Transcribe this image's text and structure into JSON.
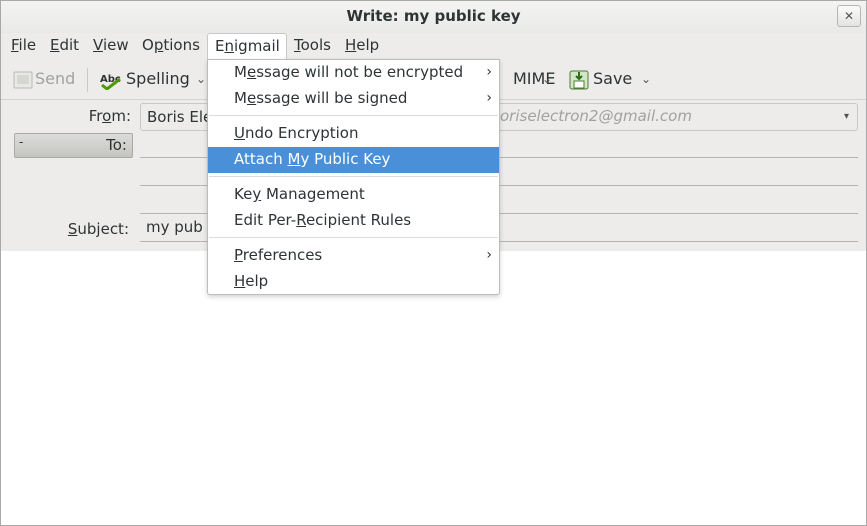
{
  "window": {
    "title": "Write: my public key",
    "close_glyph": "✕"
  },
  "menubar": [
    {
      "pre": "",
      "ul": "F",
      "post": "ile"
    },
    {
      "pre": "",
      "ul": "E",
      "post": "dit"
    },
    {
      "pre": "",
      "ul": "V",
      "post": "iew"
    },
    {
      "pre": "O",
      "ul": "p",
      "post": "tions"
    },
    {
      "pre": "E",
      "ul": "n",
      "post": "igmail"
    },
    {
      "pre": "",
      "ul": "T",
      "post": "ools"
    },
    {
      "pre": "",
      "ul": "H",
      "post": "elp"
    }
  ],
  "toolbar": {
    "send": "Send",
    "spelling": "Spelling",
    "smime": "MIME",
    "save": "Save",
    "chevron": "⌄"
  },
  "headers": {
    "from_label_pre": "Fr",
    "from_label_ul": "o",
    "from_label_post": "m:",
    "from_value": "Boris Ele",
    "from_email": "oriselectron2@gmail.com",
    "to_toggle": "-",
    "to_label": "To:",
    "subject_label_pre": "",
    "subject_label_ul": "S",
    "subject_label_post": "ubject:",
    "subject_value": "my pub",
    "combo_arrow": "▾"
  },
  "enigmail_menu": {
    "items": [
      {
        "pre": "M",
        "ul": "e",
        "post": "ssage will not be encrypted",
        "submenu": true
      },
      {
        "pre": "M",
        "ul": "e",
        "post": "ssage will be signed",
        "submenu": true
      },
      {
        "pre": "",
        "ul": "U",
        "post": "ndo Encryption",
        "submenu": false
      },
      {
        "pre": "Attach ",
        "ul": "M",
        "post": "y Public Key",
        "submenu": false,
        "highlighted": true
      },
      {
        "pre": "Ke",
        "ul": "y",
        "post": " Management",
        "submenu": false
      },
      {
        "pre": "Edit Per-",
        "ul": "R",
        "post": "ecipient Rules",
        "submenu": false
      },
      {
        "pre": "",
        "ul": "P",
        "post": "references",
        "submenu": true
      },
      {
        "pre": "",
        "ul": "H",
        "post": "elp",
        "submenu": false
      }
    ],
    "submenu_glyph": "›"
  },
  "colors": {
    "highlight": "#4a90d9",
    "chrome": "#edeceb"
  }
}
